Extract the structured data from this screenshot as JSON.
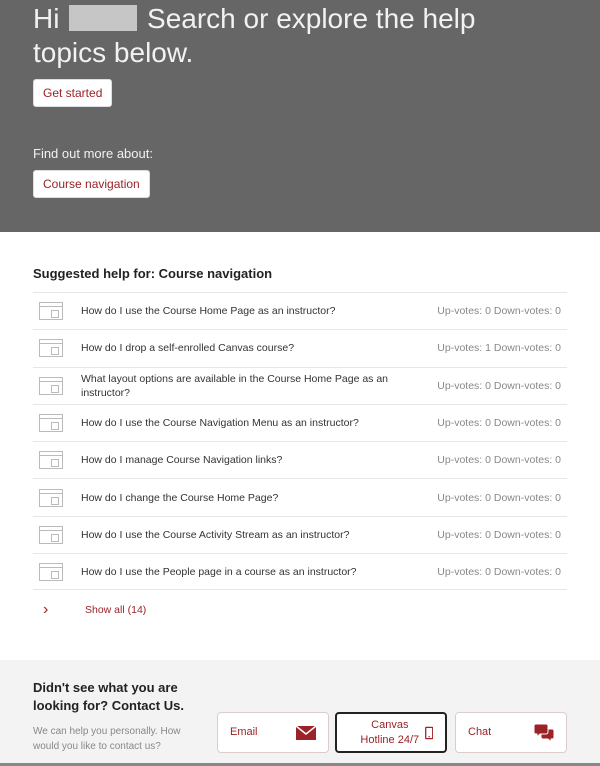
{
  "hero": {
    "greeting": "Hi",
    "title": "Search or explore the help topics below.",
    "get_started": "Get started",
    "find_out": "Find out more about:",
    "topic": "Course navigation"
  },
  "main": {
    "heading": "Suggested help for: Course navigation",
    "articles": [
      {
        "q": "How do I use the Course Home Page as an instructor?",
        "votes": "Up-votes: 0  Down-votes: 0"
      },
      {
        "q": "How do I drop a self-enrolled Canvas course?",
        "votes": "Up-votes: 1  Down-votes: 0"
      },
      {
        "q": "What layout options are available in the Course Home Page as an instructor?",
        "votes": "Up-votes: 0  Down-votes: 0"
      },
      {
        "q": "How do I use the Course Navigation Menu as an instructor?",
        "votes": "Up-votes: 0  Down-votes: 0"
      },
      {
        "q": "How do I manage Course Navigation links?",
        "votes": "Up-votes: 0  Down-votes: 0"
      },
      {
        "q": "How do I change the Course Home Page?",
        "votes": "Up-votes: 0  Down-votes: 0"
      },
      {
        "q": "How do I use the Course Activity Stream as an instructor?",
        "votes": "Up-votes: 0  Down-votes: 0"
      },
      {
        "q": "How do I use the People page in a course as an instructor?",
        "votes": "Up-votes: 0  Down-votes: 0"
      }
    ],
    "show_all": "Show all (14)"
  },
  "footer": {
    "heading": "Didn't see what you are looking for? Contact Us.",
    "text": "We can help you personally. How would you like to contact us?",
    "email": "Email",
    "hotline": "Canvas Hotline 24/7",
    "chat": "Chat"
  },
  "colors": {
    "accent": "#9b2226",
    "hero_bg": "#666666"
  }
}
